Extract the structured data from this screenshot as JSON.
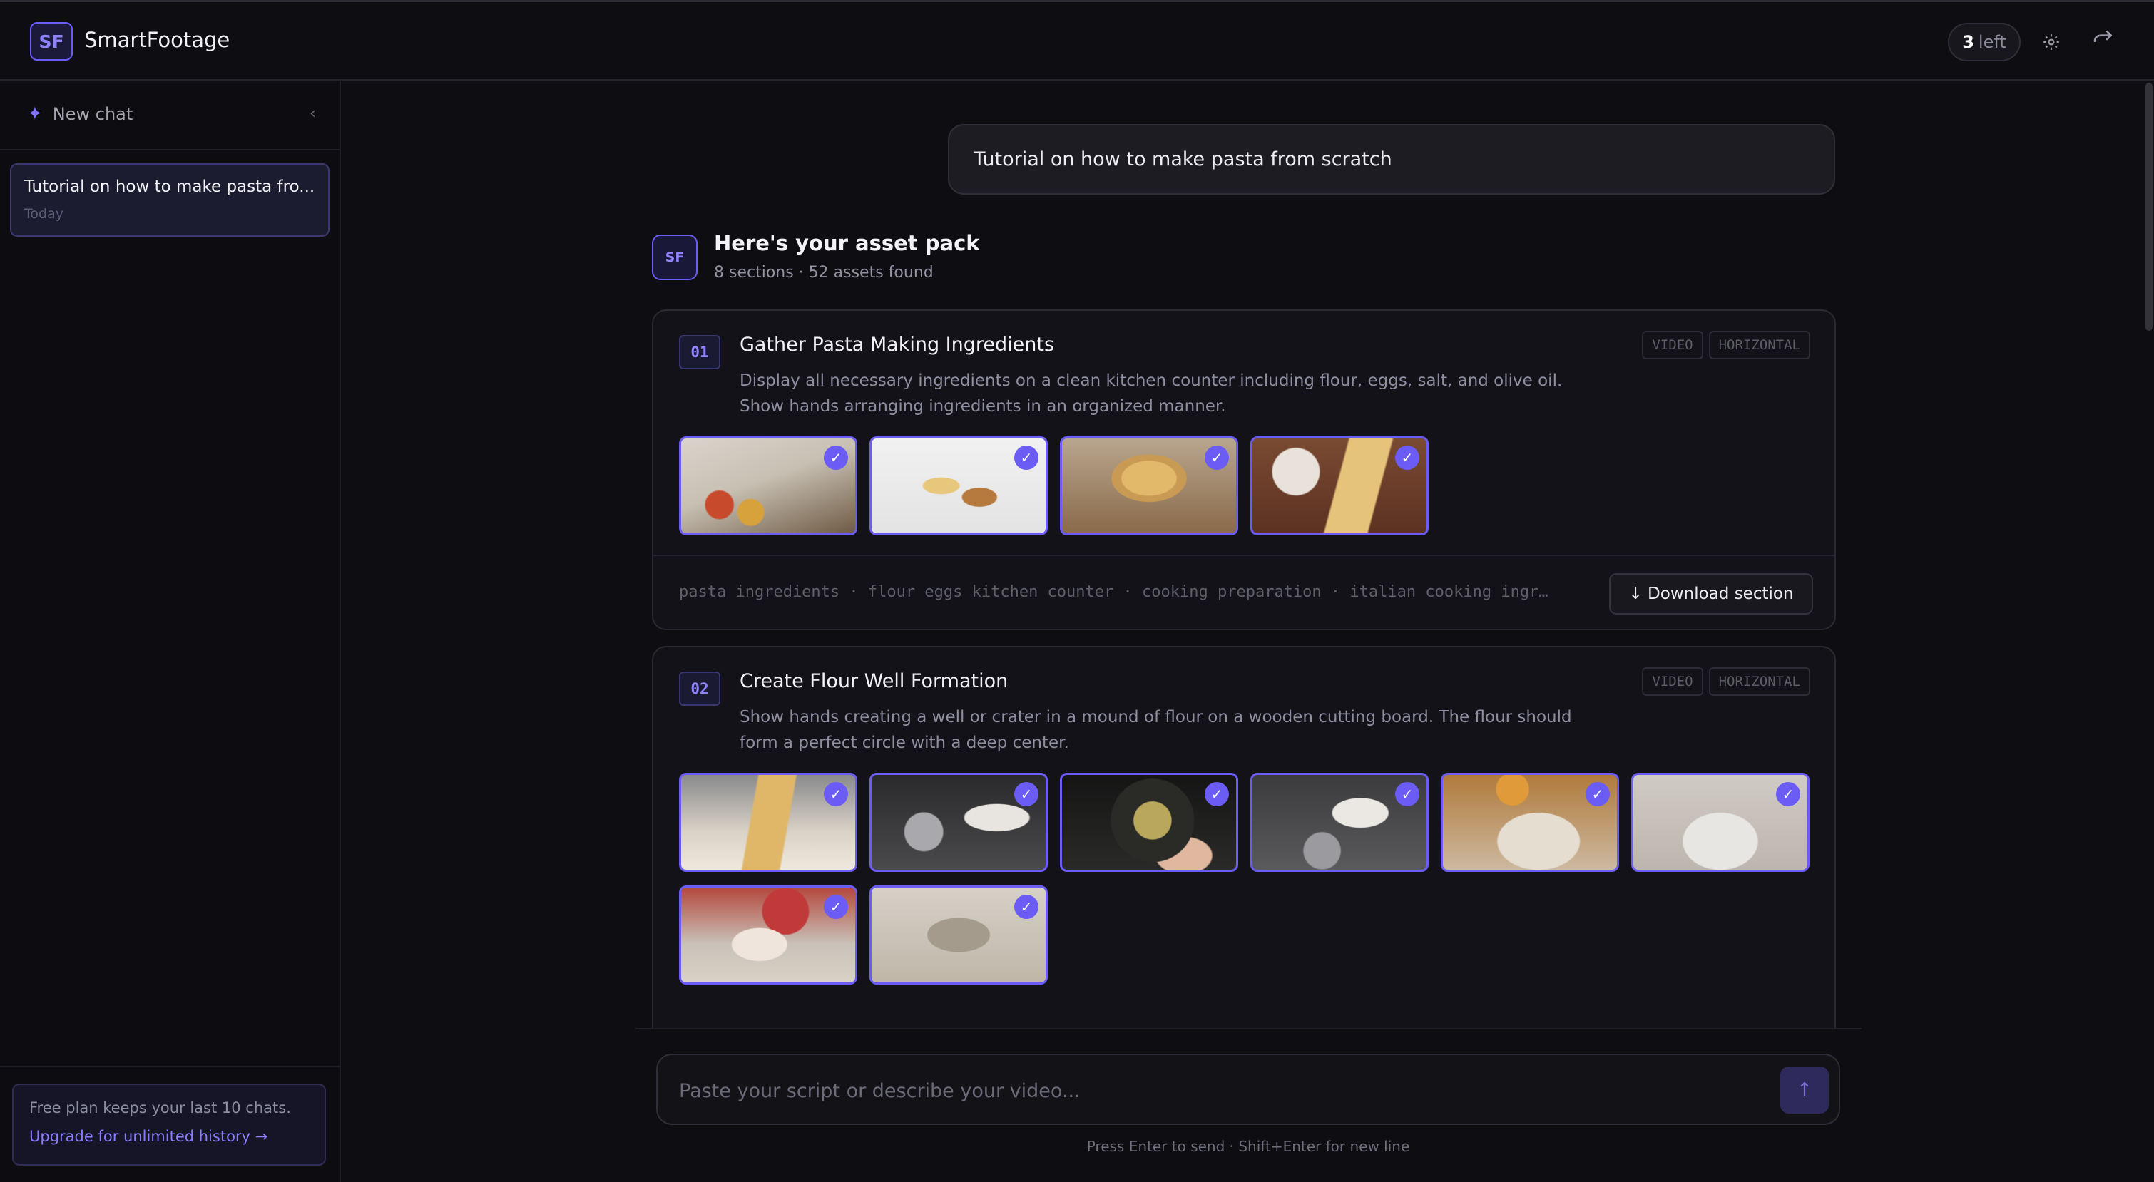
{
  "app": {
    "logo_initials": "SF",
    "name": "SmartFootage"
  },
  "header": {
    "quota_count": "3",
    "quota_label": "left",
    "settings_icon": "gear-icon",
    "logout_icon": "logout-arrow-icon"
  },
  "sidebar": {
    "new_chat_label": "New chat",
    "collapse_icon": "chevron-left-icon",
    "chats": [
      {
        "title": "Tutorial on how to make pasta fro...",
        "date": "Today"
      }
    ],
    "plan_notice": "Free plan keeps your last 10 chats.",
    "upgrade_link": "Upgrade for unlimited history →"
  },
  "conversation": {
    "user_message": "Tutorial on how to make pasta from scratch",
    "assistant": {
      "avatar": "SF",
      "title": "Here's your asset pack",
      "subtitle": "8 sections · 52 assets found"
    },
    "sections": [
      {
        "number": "01",
        "title": "Gather Pasta Making Ingredients",
        "description": "Display all necessary ingredients on a clean kitchen counter including flour, eggs, salt, and olive oil. Show hands arranging ingredients in an organized manner.",
        "tags": [
          "VIDEO",
          "HORIZONTAL"
        ],
        "thumbnail_count": 4,
        "keywords": "pasta ingredients · flour eggs kitchen counter · cooking preparation · italian cooking ingr…",
        "download_label": "↓ Download section"
      },
      {
        "number": "02",
        "title": "Create Flour Well Formation",
        "description": "Show hands creating a well or crater in a mound of flour on a wooden cutting board. The flour should form a perfect circle with a deep center.",
        "tags": [
          "VIDEO",
          "HORIZONTAL"
        ],
        "thumbnail_count": 8
      }
    ]
  },
  "composer": {
    "placeholder": "Paste your script or describe your video...",
    "send_icon": "arrow-up-icon",
    "hint": "Press Enter to send · Shift+Enter for new line"
  },
  "colors": {
    "accent": "#6b5cf5",
    "background": "#0e0e12",
    "card": "#121218"
  }
}
